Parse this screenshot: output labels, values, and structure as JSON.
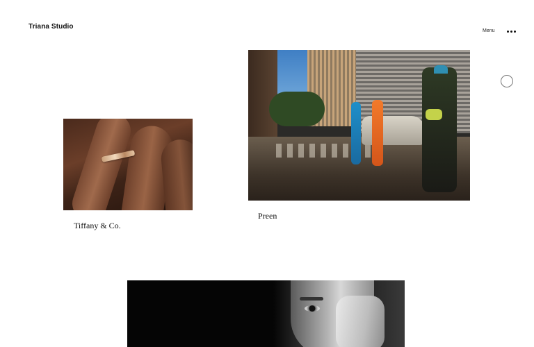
{
  "header": {
    "brand": "Triana Studio",
    "menu_label": "Menu"
  },
  "projects": [
    {
      "caption": "Tiffany & Co."
    },
    {
      "caption": "Preen"
    }
  ],
  "icons": {
    "menu": "more-dots-icon",
    "cursor": "circle-cursor-icon"
  }
}
